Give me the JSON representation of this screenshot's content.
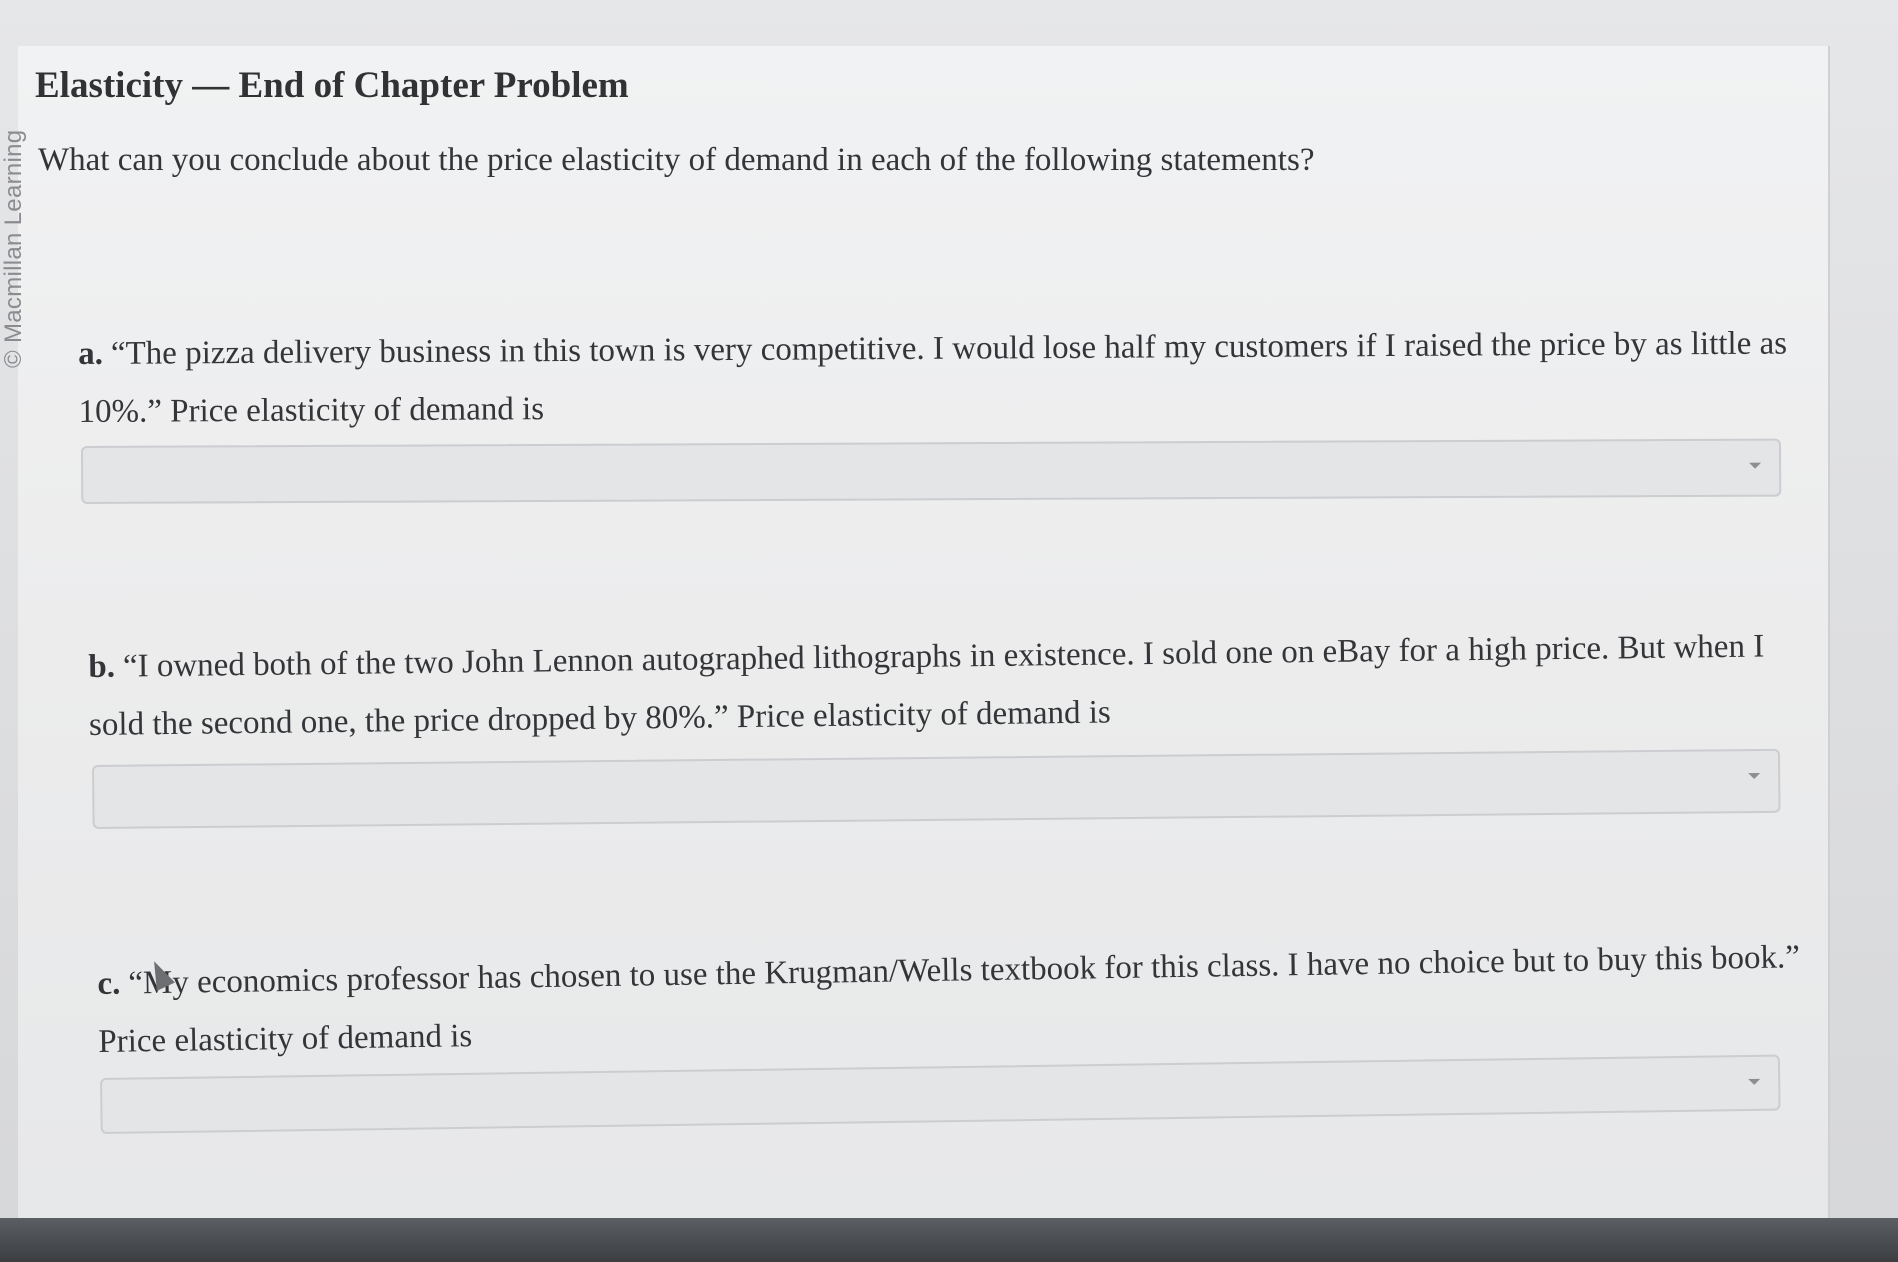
{
  "sidebar": {
    "copyright": "© Macmillan Learning"
  },
  "header": {
    "title": "Elasticity — End of Chapter Problem"
  },
  "main": {
    "question": "What can you conclude about the price elasticity of demand in each of the following statements?",
    "items": [
      {
        "label": "a.",
        "text": "“The pizza delivery business in this town is very competitive. I would lose half my customers if I raised the price by as little as 10%.” Price elasticity of demand is",
        "select_value": ""
      },
      {
        "label": "b.",
        "text": "“I owned both of the two John Lennon autographed lithographs in existence. I sold one on eBay for a high price. But when I sold the second one, the price dropped by 80%.” Price elasticity of demand is",
        "select_value": ""
      },
      {
        "label": "c.",
        "text": "“My economics professor has chosen to use the Krugman/Wells textbook for this class. I have no choice but to buy this book.” Price elasticity of demand is",
        "select_value": ""
      }
    ]
  },
  "icons": {
    "dropdown": "chevron-down-icon",
    "cursor": "mouse-pointer-icon"
  },
  "colors": {
    "panel": "#ececed",
    "text": "#333538",
    "select_bg": "#e4e5e7",
    "select_border": "#cbcdd0"
  }
}
